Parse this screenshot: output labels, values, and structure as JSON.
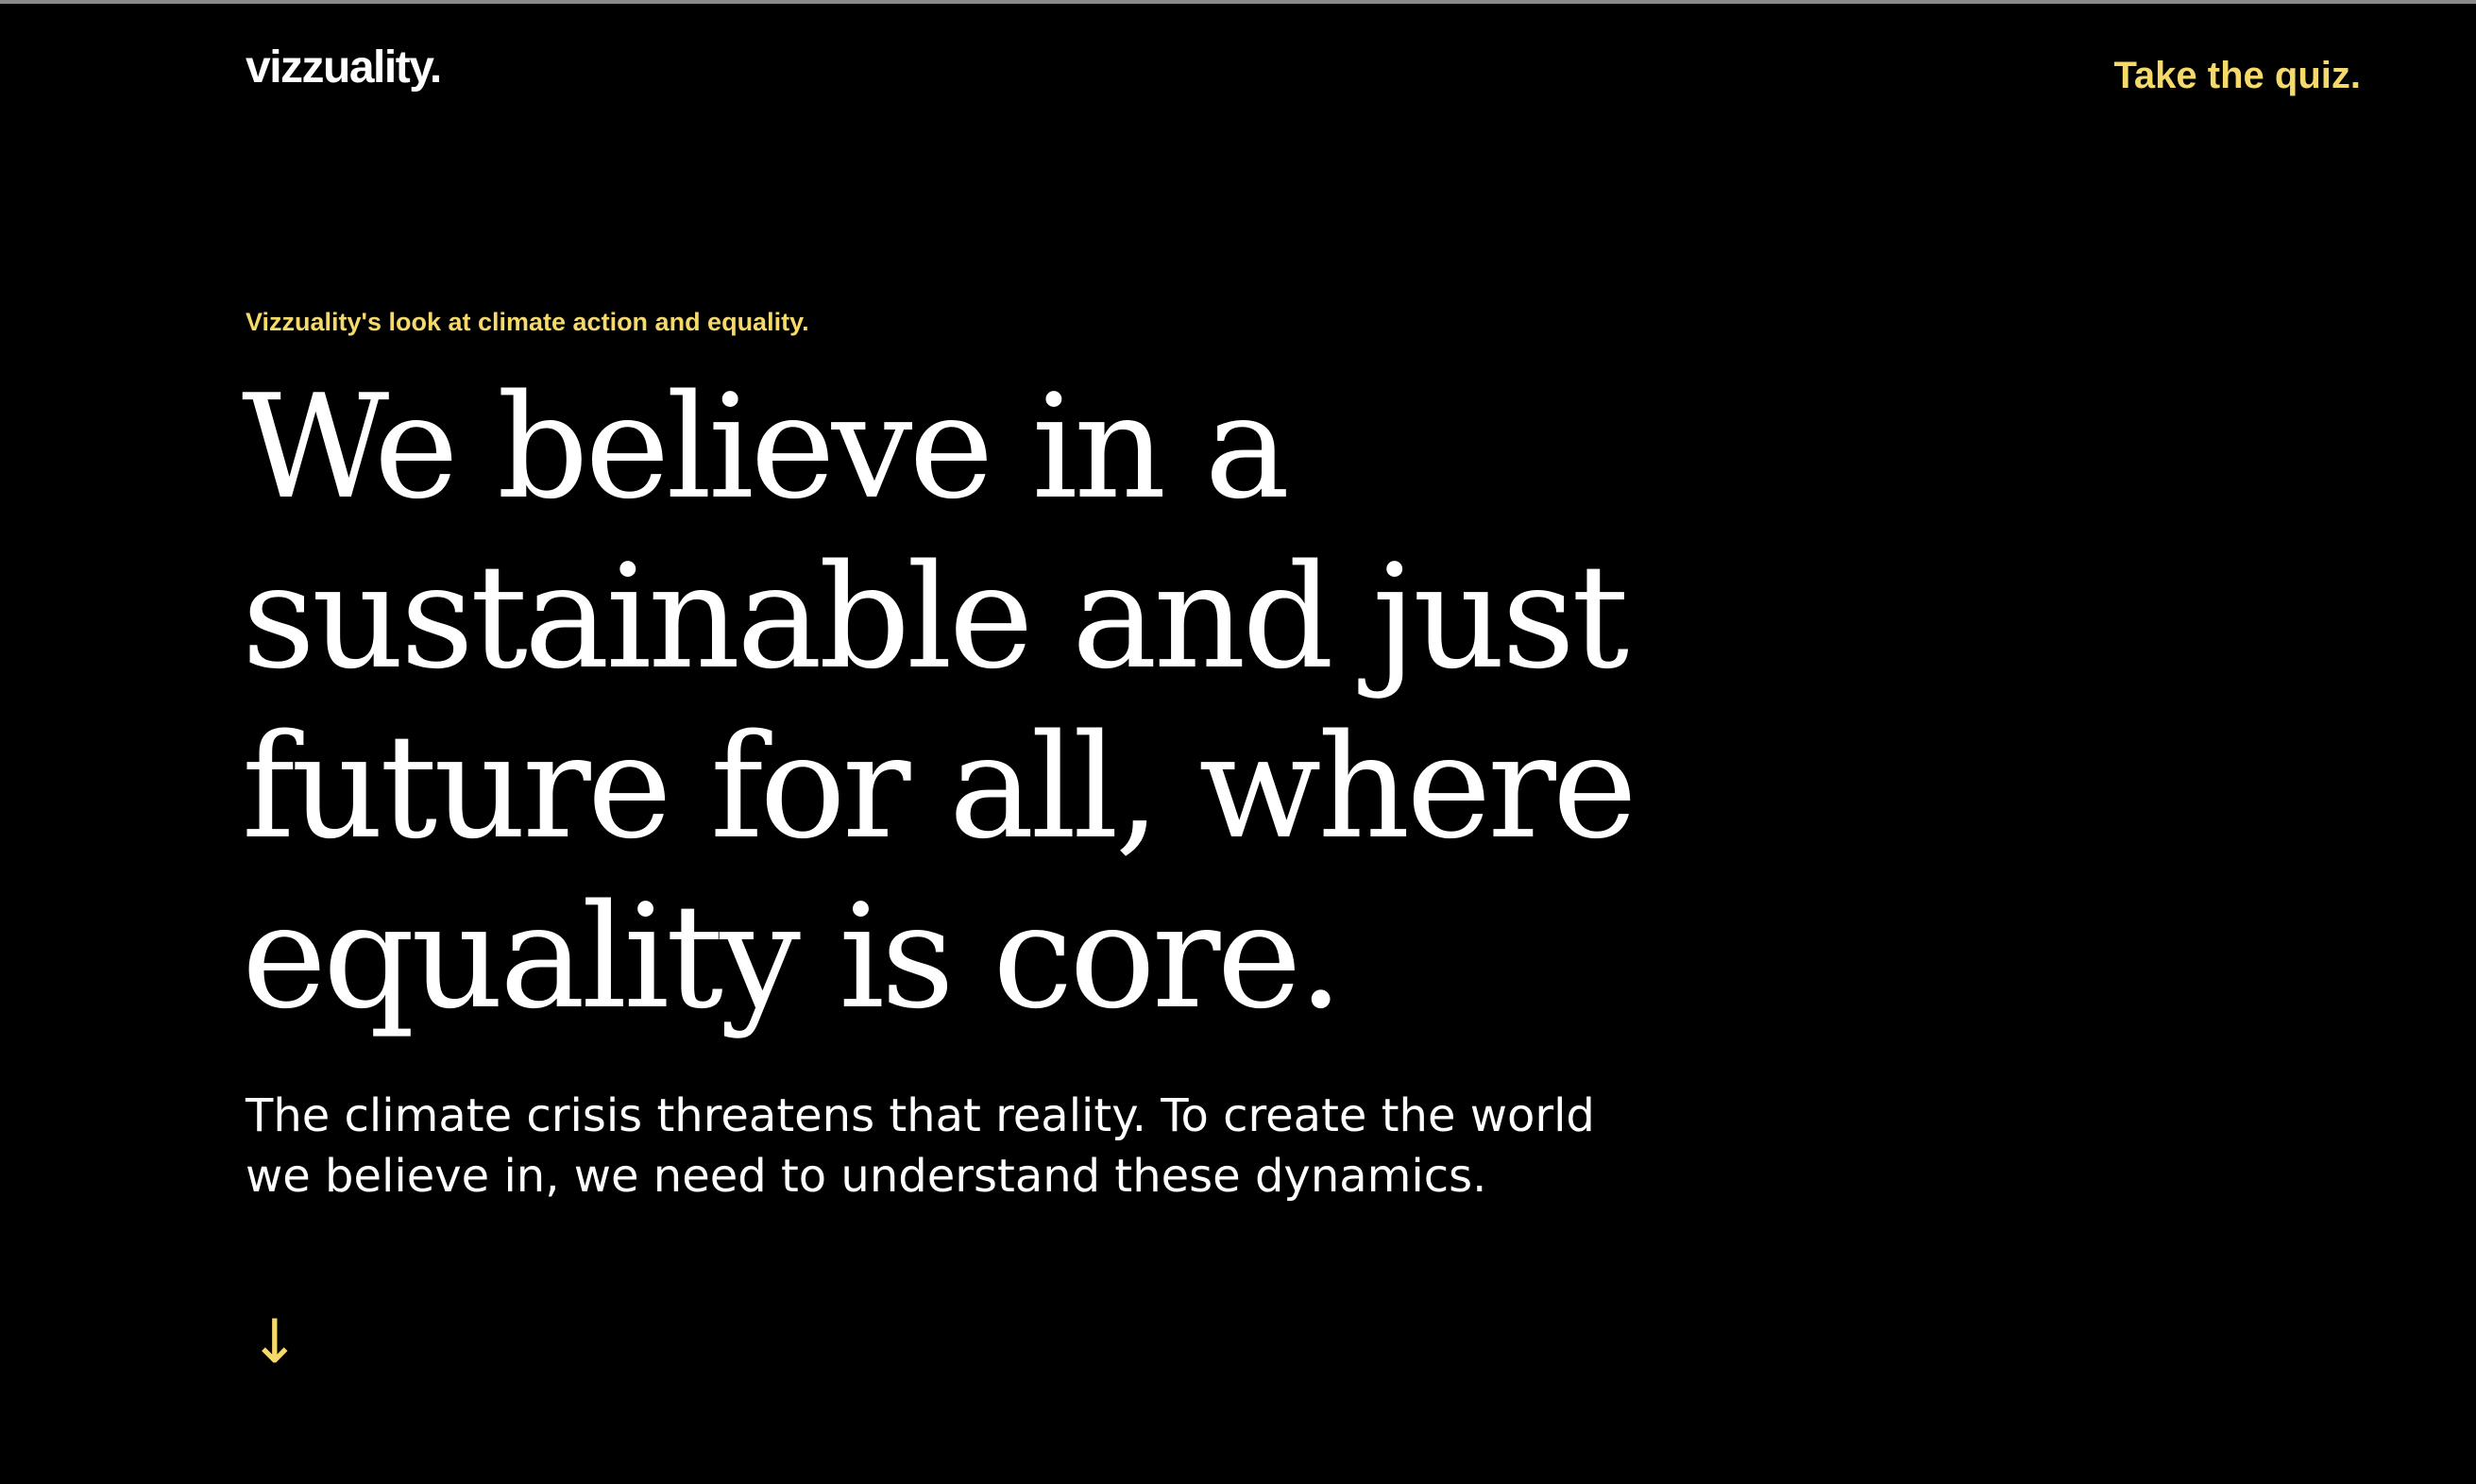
{
  "header": {
    "logo_text": "vizzuality.",
    "quiz_link_label": "Take the quiz."
  },
  "hero": {
    "eyebrow": "Vizzuality's look at climate action and equality.",
    "headline": "We believe in a sustainable and just future for all, where equality is core.",
    "subtext": "The climate crisis threatens that reality. To create the world we believe in, we need to understand these dynamics."
  },
  "scroll": {
    "icon": "arrow-down-icon",
    "glyph": "↓"
  },
  "colors": {
    "background": "#000000",
    "accent": "#f5d96b",
    "text": "#ffffff"
  }
}
